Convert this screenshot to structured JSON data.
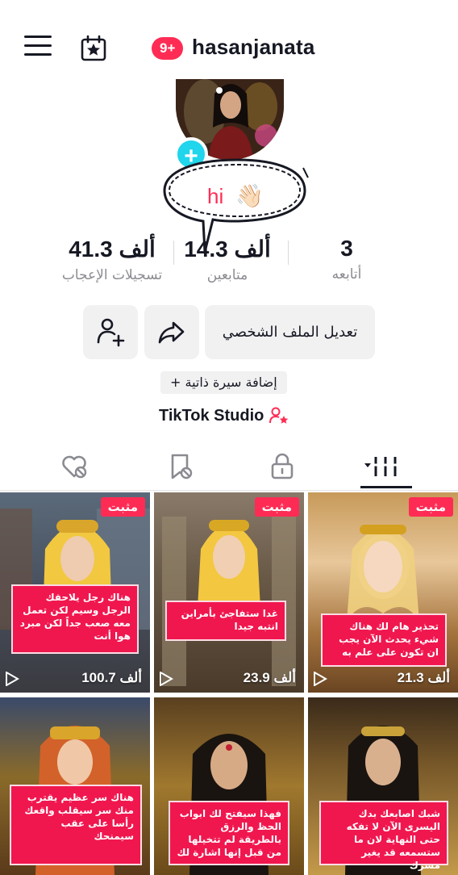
{
  "header": {
    "notification_count": "9+",
    "username": "hasanjanata"
  },
  "profile": {
    "note_text": "hi",
    "note_emoji": "👋🏻",
    "stats": [
      {
        "value": "3",
        "label": "أتابعه"
      },
      {
        "value": "14.3 ألف",
        "label": "متابعين"
      },
      {
        "value": "41.3 ألف",
        "label": "تسجيلات الإعجاب"
      }
    ],
    "edit_label": "تعديل الملف الشخصي",
    "bio_label": "+ إضافة سيرة ذاتية",
    "studio_label": "TikTok Studio"
  },
  "colors": {
    "accent": "#fe2c55",
    "follow_plus": "#20d5ec"
  },
  "tabs": [
    "videos-grid",
    "reposts",
    "private",
    "favorites",
    "liked"
  ],
  "videos": [
    {
      "pinned": "مثبت",
      "views": "21.3 ألف",
      "caption": "تحذير هام لك هناك شيء يحدث الآن يجب ان تكون على علم به"
    },
    {
      "pinned": "مثبت",
      "views": "23.9 ألف",
      "caption": "غدا ستفاجئ بأمراين انتبه جيدا"
    },
    {
      "pinned": "مثبت",
      "views": "100.7 ألف",
      "caption": "هناك رجل يلاحقك الرجل وسيم لكن تعمل معه صعب جداً لكن مبرد هوا أنت"
    },
    {
      "pinned": "",
      "views": "",
      "caption": "شبك اصابعك بدك اليسرى الآن لا تفكه حتى النهاية لان ما ستسمعه قد يغير مسرك"
    },
    {
      "pinned": "",
      "views": "",
      "caption": "فهذا سيفتح لك ابواب الحظ والرزق بالطريقة لم تتخيلها من قبل إنها اشارة لك"
    },
    {
      "pinned": "",
      "views": "",
      "caption": "هناك سر عظيم يقترب منك سر سيقلب واقعك رأسا على عقب سيمنحك"
    }
  ]
}
